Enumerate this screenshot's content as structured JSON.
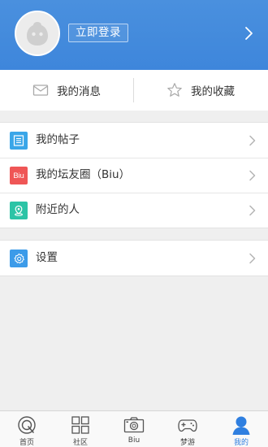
{
  "header": {
    "login_label": "立即登录"
  },
  "quick": {
    "messages_label": "我的消息",
    "favorites_label": "我的收藏"
  },
  "menu": {
    "posts_label": "我的帖子",
    "circle_label": "我的坛友圈（Biu）",
    "circle_icon_text": "Biu",
    "nearby_label": "附近的人",
    "settings_label": "设置"
  },
  "tabs": [
    {
      "label": "首页",
      "icon": "home-compass-icon",
      "active": false
    },
    {
      "label": "社区",
      "icon": "grid-icon",
      "active": false
    },
    {
      "label": "Biu",
      "icon": "camera-icon",
      "active": false
    },
    {
      "label": "梦游",
      "icon": "gamepad-icon",
      "active": false
    },
    {
      "label": "我的",
      "icon": "user-icon",
      "active": true
    }
  ],
  "colors": {
    "header_blue": "#4a90de",
    "posts_icon": "#3aa6e8",
    "circle_icon": "#ef5656",
    "nearby_icon": "#2cc4a6",
    "settings_icon": "#3c9be9",
    "active_tab": "#2f7fe0"
  }
}
